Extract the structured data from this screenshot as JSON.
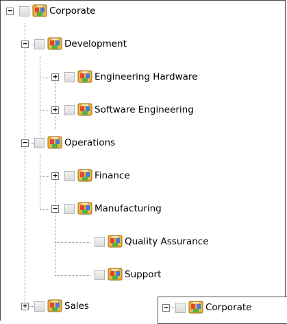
{
  "tree": {
    "root": {
      "label": "Corporate",
      "toggle": "−"
    },
    "development": {
      "label": "Development",
      "toggle": "−"
    },
    "engineering_hardware": {
      "label": "Engineering Hardware",
      "toggle": "+"
    },
    "software_engineering": {
      "label": "Software Engineering",
      "toggle": "+"
    },
    "operations": {
      "label": "Operations",
      "toggle": "−"
    },
    "finance": {
      "label": "Finance",
      "toggle": "+"
    },
    "manufacturing": {
      "label": "Manufacturing",
      "toggle": "−"
    },
    "quality_assurance": {
      "label": "Quality Assurance"
    },
    "support": {
      "label": "Support"
    },
    "sales": {
      "label": "Sales",
      "toggle": "+"
    }
  },
  "drag_ghost": {
    "label": "Corporate",
    "toggle": "−"
  },
  "icon": "org-chart-icon",
  "colors": {
    "line": "#8a8a8a",
    "border": "#4a4a4a",
    "checkbox": "#dcdcdc"
  }
}
